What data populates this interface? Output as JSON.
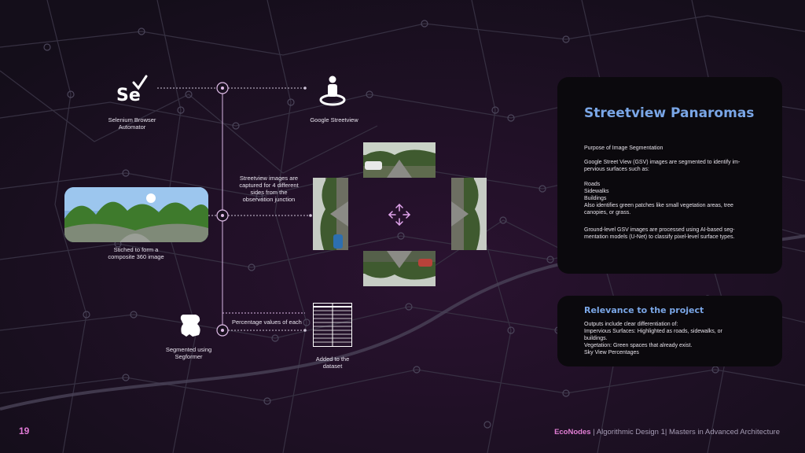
{
  "slide": {
    "page_number": "19",
    "footer": {
      "brand": "EcoNodes",
      "separator": " | ",
      "course": "Algorithmic Design 1",
      "separator2": "| ",
      "program": "Masters in Advanced Architecture"
    }
  },
  "workflow": {
    "selenium": {
      "logo_text": "Se",
      "label": "Selenium Browser\nAutomator"
    },
    "google_streetview": {
      "label": "Google Streetview"
    },
    "capture_note": "Streetview images are\ncaptured for 4 different\nsides from the\nobservation junction",
    "composite_label": "Stiched to form a\ncomposite 360 image",
    "segformer_label": "Segmented using\nSegformer",
    "percentage_note": "Percentage values of each",
    "dataset_label": "Added to the\ndataset"
  },
  "streetview_card": {
    "title": "Streetview Panaromas",
    "paragraphs": [
      "Purpose of Image Segmentation",
      "Google Street View (GSV) images are segmented to identify im-\npervious surfaces such as:",
      "Roads\nSidewalks\nBuildings\nAlso identifies green patches like small vegetation areas, tree\ncanopies, or grass.",
      "Ground-level GSV images are processed using AI-based seg-\nmentation models (U-Net) to classify pixel-level surface types."
    ]
  },
  "relevance_card": {
    "title": "Relevance to the project",
    "text": "Outputs include clear differentiation of:\nImpervious Surfaces: Highlighted as roads, sidewalks, or\nbuildings.\nVegetation: Green spaces that already exist.\nSky View Percentages"
  },
  "colors": {
    "background": "#1a1120",
    "accent_pink": "#e07ad6",
    "title_blue": "#7aa6e6",
    "node_ring": "#d8b6e4"
  }
}
